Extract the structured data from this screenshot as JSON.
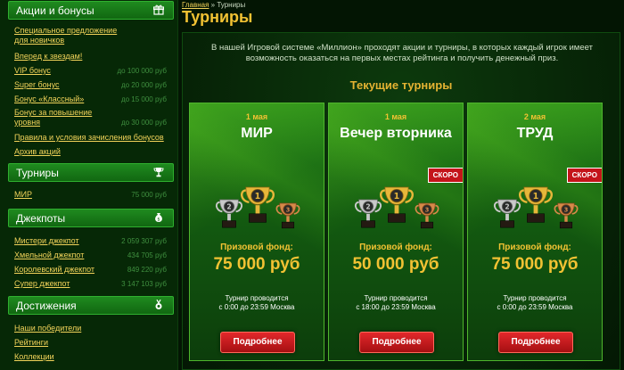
{
  "sidebar": {
    "sections": {
      "promos": {
        "title": "Акции и бонусы",
        "icon": "gift-icon",
        "items": [
          {
            "label": "Специальное предложение\nдля новичков",
            "value": ""
          },
          {
            "label": "Вперед к звездам!",
            "value": ""
          },
          {
            "label": "VIP бонус",
            "value": "до 100 000 руб"
          },
          {
            "label": "Super бонус",
            "value": "до 20 000 руб"
          },
          {
            "label": "Бонус «Классный»",
            "value": "до 15 000 руб"
          },
          {
            "label": "Бонус за повышение\nуровня",
            "value": "до 30 000 руб"
          },
          {
            "label": "Правила и условия зачисления бонусов",
            "value": ""
          },
          {
            "label": "Архив акций",
            "value": ""
          }
        ]
      },
      "tournaments": {
        "title": "Турниры",
        "icon": "trophy-icon",
        "items": [
          {
            "label": "МИР",
            "value": "75 000 руб"
          }
        ]
      },
      "jackpots": {
        "title": "Джекпоты",
        "icon": "money-bag-icon",
        "items": [
          {
            "label": "Мистери джекпот",
            "value": "2 059 307 руб"
          },
          {
            "label": "Хмельной джекпот",
            "value": "434 705 руб"
          },
          {
            "label": "Королевский джекпот",
            "value": "849 220 руб"
          },
          {
            "label": "Супер джекпот",
            "value": "3 147 103 руб"
          }
        ]
      },
      "achievements": {
        "title": "Достижения",
        "icon": "medal-icon",
        "items": [
          {
            "label": "Наши победители",
            "value": ""
          },
          {
            "label": "Рейтинги",
            "value": ""
          },
          {
            "label": "Коллекции",
            "value": ""
          }
        ]
      }
    }
  },
  "breadcrumb": {
    "home": "Главная",
    "separator": " » ",
    "current": "Турниры"
  },
  "page_title": "Турниры",
  "intro": "В нашей Игровой системе «Миллион» проходят акции и турниры, в которых каждый игрок имеет возможность оказаться на первых местах рейтинга и получить денежный приз.",
  "current_title": "Текущие турниры",
  "fund_label": "Призовой фонд:",
  "more_label": "Подробнее",
  "tournaments": [
    {
      "date": "1 мая",
      "name": "МИР",
      "badge": "",
      "fund": "75 000 руб",
      "held_line1": "Турнир проводится",
      "held_line2": "с 0:00 до 23:59 Москва"
    },
    {
      "date": "1 мая",
      "name": "Вечер вторника",
      "badge": "СКОРО",
      "fund": "50 000 руб",
      "held_line1": "Турнир проводится",
      "held_line2": "с 18:00 до 23:59 Москва"
    },
    {
      "date": "2 мая",
      "name": "ТРУД",
      "badge": "СКОРО",
      "fund": "75 000 руб",
      "held_line1": "Турнир проводится",
      "held_line2": "с 0:00 до 23:59 Москва"
    }
  ],
  "cup_places": [
    "2",
    "1",
    "3"
  ],
  "colors": {
    "accent": "#f2c233",
    "link": "#f2d35a",
    "button": "#c4141a",
    "header": "#1f8a1f"
  }
}
